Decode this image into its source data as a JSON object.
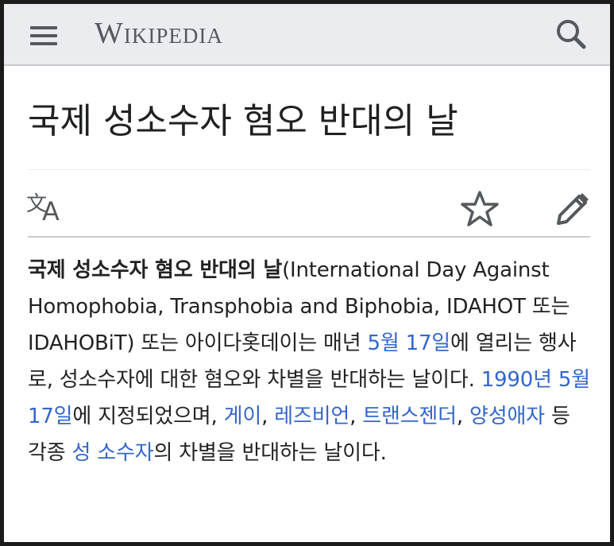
{
  "header": {
    "logo_text": "Wikipedia",
    "menu_icon": "hamburger-menu-icon",
    "search_icon": "search-icon"
  },
  "page": {
    "title": "국제 성소수자 혐오 반대의 날"
  },
  "actions": {
    "language_icon": "translate-icon",
    "watch_icon": "star-icon",
    "edit_icon": "pencil-icon"
  },
  "article": {
    "bold_term": "국제 성소수자 혐오 반대의 날",
    "t1": "(International Day Against Homophobia, Transphobia and Biphobia, IDAHOT 또는 IDAHOBiT) 또는 아이다홋데이는 매년 ",
    "link_may17": "5월 17일",
    "t2": "에 열리는 행사로, 성소수자에 대한 혐오와 차별을 반대하는 날이다. ",
    "link_1990": "1990년",
    "t3": " ",
    "link_may17_2": "5월 17일",
    "t4": "에 지정되었으며, ",
    "link_gay": "게이",
    "t5": ", ",
    "link_lesbian": "레즈비언",
    "t6": ", ",
    "link_transgender": "트랜스젠더",
    "t7": ", ",
    "link_bisexual": "양성애자",
    "t8": " 등 각종 ",
    "link_sexual_minority": "성 소수자",
    "t9": "의 차별을 반대하는 날이다."
  },
  "colors": {
    "link": "#3366cc",
    "header_bg": "#eaecf0",
    "icon": "#54595d"
  }
}
